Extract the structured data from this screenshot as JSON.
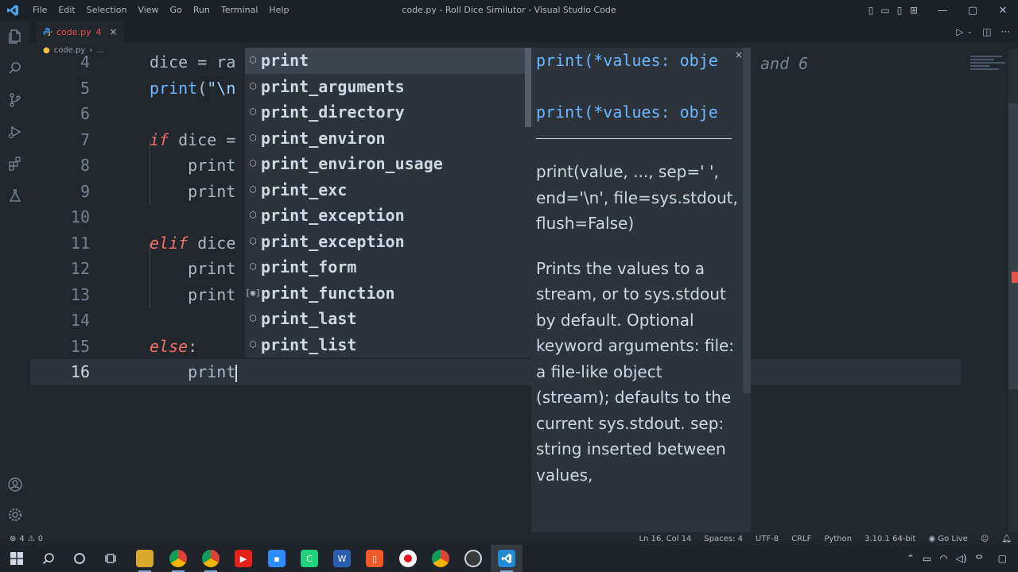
{
  "window": {
    "title": "code.py - Roll Dice Similutor - Visual Studio Code",
    "menu": [
      "File",
      "Edit",
      "Selection",
      "View",
      "Go",
      "Run",
      "Terminal",
      "Help"
    ],
    "controls": {
      "minimize": "—",
      "maximize": "▢",
      "close": "✕"
    }
  },
  "tab": {
    "name": "code.py",
    "problem_count": "4",
    "close": "×"
  },
  "breadcrumb": {
    "file": "code.py",
    "sep": "›",
    "more": "..."
  },
  "editor": {
    "lines": [
      {
        "num": "4",
        "parts": [
          {
            "t": "dice = ra",
            "c": ""
          }
        ]
      },
      {
        "num": "5",
        "parts": [
          {
            "t": "print",
            "c": "fn"
          },
          {
            "t": "(",
            "c": ""
          },
          {
            "t": "\"\\n",
            "c": "str"
          }
        ]
      },
      {
        "num": "6",
        "parts": []
      },
      {
        "num": "7",
        "parts": [
          {
            "t": "if",
            "c": "kw"
          },
          {
            "t": " dice =",
            "c": ""
          }
        ]
      },
      {
        "num": "8",
        "parts": [
          {
            "t": "    print",
            "c": ""
          }
        ]
      },
      {
        "num": "9",
        "parts": [
          {
            "t": "    print",
            "c": ""
          }
        ]
      },
      {
        "num": "10",
        "parts": []
      },
      {
        "num": "11",
        "parts": [
          {
            "t": "elif",
            "c": "kw"
          },
          {
            "t": " dice",
            "c": ""
          }
        ]
      },
      {
        "num": "12",
        "parts": [
          {
            "t": "    print",
            "c": ""
          }
        ]
      },
      {
        "num": "13",
        "parts": [
          {
            "t": "    print",
            "c": ""
          }
        ]
      },
      {
        "num": "14",
        "parts": []
      },
      {
        "num": "15",
        "parts": [
          {
            "t": "else",
            "c": "kw"
          },
          {
            "t": ":",
            "c": ""
          }
        ]
      },
      {
        "num": "16",
        "parts": [
          {
            "t": "    print",
            "c": ""
          }
        ]
      }
    ],
    "behind_comment": "and 6"
  },
  "suggest": {
    "items": [
      {
        "label": "print",
        "icon": "⬡"
      },
      {
        "label": "print_arguments",
        "icon": "⬡"
      },
      {
        "label": "print_directory",
        "icon": "⬡"
      },
      {
        "label": "print_environ",
        "icon": "⬡"
      },
      {
        "label": "print_environ_usage",
        "icon": "⬡"
      },
      {
        "label": "print_exc",
        "icon": "⬡"
      },
      {
        "label": "print_exception",
        "icon": "⬡"
      },
      {
        "label": "print_exception",
        "icon": "⬡"
      },
      {
        "label": "print_form",
        "icon": "⬡"
      },
      {
        "label": "print_function",
        "icon": "[◉]"
      },
      {
        "label": "print_last",
        "icon": "⬡"
      },
      {
        "label": "print_list",
        "icon": "⬡"
      }
    ]
  },
  "details": {
    "signature1": "print(*values: obje",
    "signature2": "print(*values: obje",
    "close": "×",
    "doc": "print(value, ..., sep=' ', end='\\n', file=sys.stdout, flush=False)",
    "desc": "Prints the values to a stream, or to sys.stdout by default. Optional keyword arguments: file: a file-like object (stream); defaults to the current sys.stdout. sep: string inserted between values,"
  },
  "status": {
    "errors": "4",
    "warnings": "0",
    "position": "Ln 16, Col 14",
    "spaces": "Spaces: 4",
    "encoding": "UTF-8",
    "eol": "CRLF",
    "language": "Python",
    "interpreter": "3.10.1 64-bit",
    "golive": "Go Live"
  },
  "colors": {
    "bg": "#22272e",
    "accent": "#6cb6ff",
    "error": "#e5534b"
  }
}
